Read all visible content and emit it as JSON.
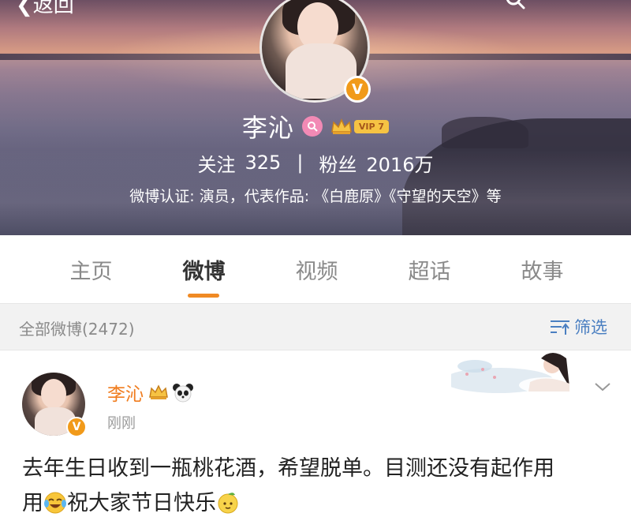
{
  "header": {
    "back_label": "返回",
    "profile_name": "李沁",
    "vip_level": "VIP 7",
    "verified_badge": "V",
    "following_label": "关注",
    "following_count": "325",
    "separator": "|",
    "followers_label": "粉丝",
    "followers_count": "2016万",
    "verification": "微博认证: 演员，代表作品: 《白鹿原》《守望的天空》等"
  },
  "tabs": [
    {
      "label": "主页",
      "active": false
    },
    {
      "label": "微博",
      "active": true
    },
    {
      "label": "视频",
      "active": false
    },
    {
      "label": "超话",
      "active": false
    },
    {
      "label": "故事",
      "active": false
    }
  ],
  "filter_bar": {
    "count_label": "全部微博(2472)",
    "filter_label": "筛选"
  },
  "post": {
    "author": "李沁",
    "time": "刚刚",
    "text_part1": "去年生日收到一瓶桃花酒，希望脱单。目测还没有起作用",
    "text_part2": "祝大家节日快乐"
  },
  "colors": {
    "accent_orange": "#f07c1e",
    "tab_underline": "#f08a24",
    "filter_blue": "#4a7fc1",
    "verified_orange": "#f19a1a"
  },
  "icons": [
    "back-arrow-icon",
    "search-icon",
    "female-icon",
    "crown-icon",
    "panda-icon",
    "filter-icon",
    "chevron-down-icon",
    "laugh-cry-emoji",
    "mango-emoji"
  ]
}
